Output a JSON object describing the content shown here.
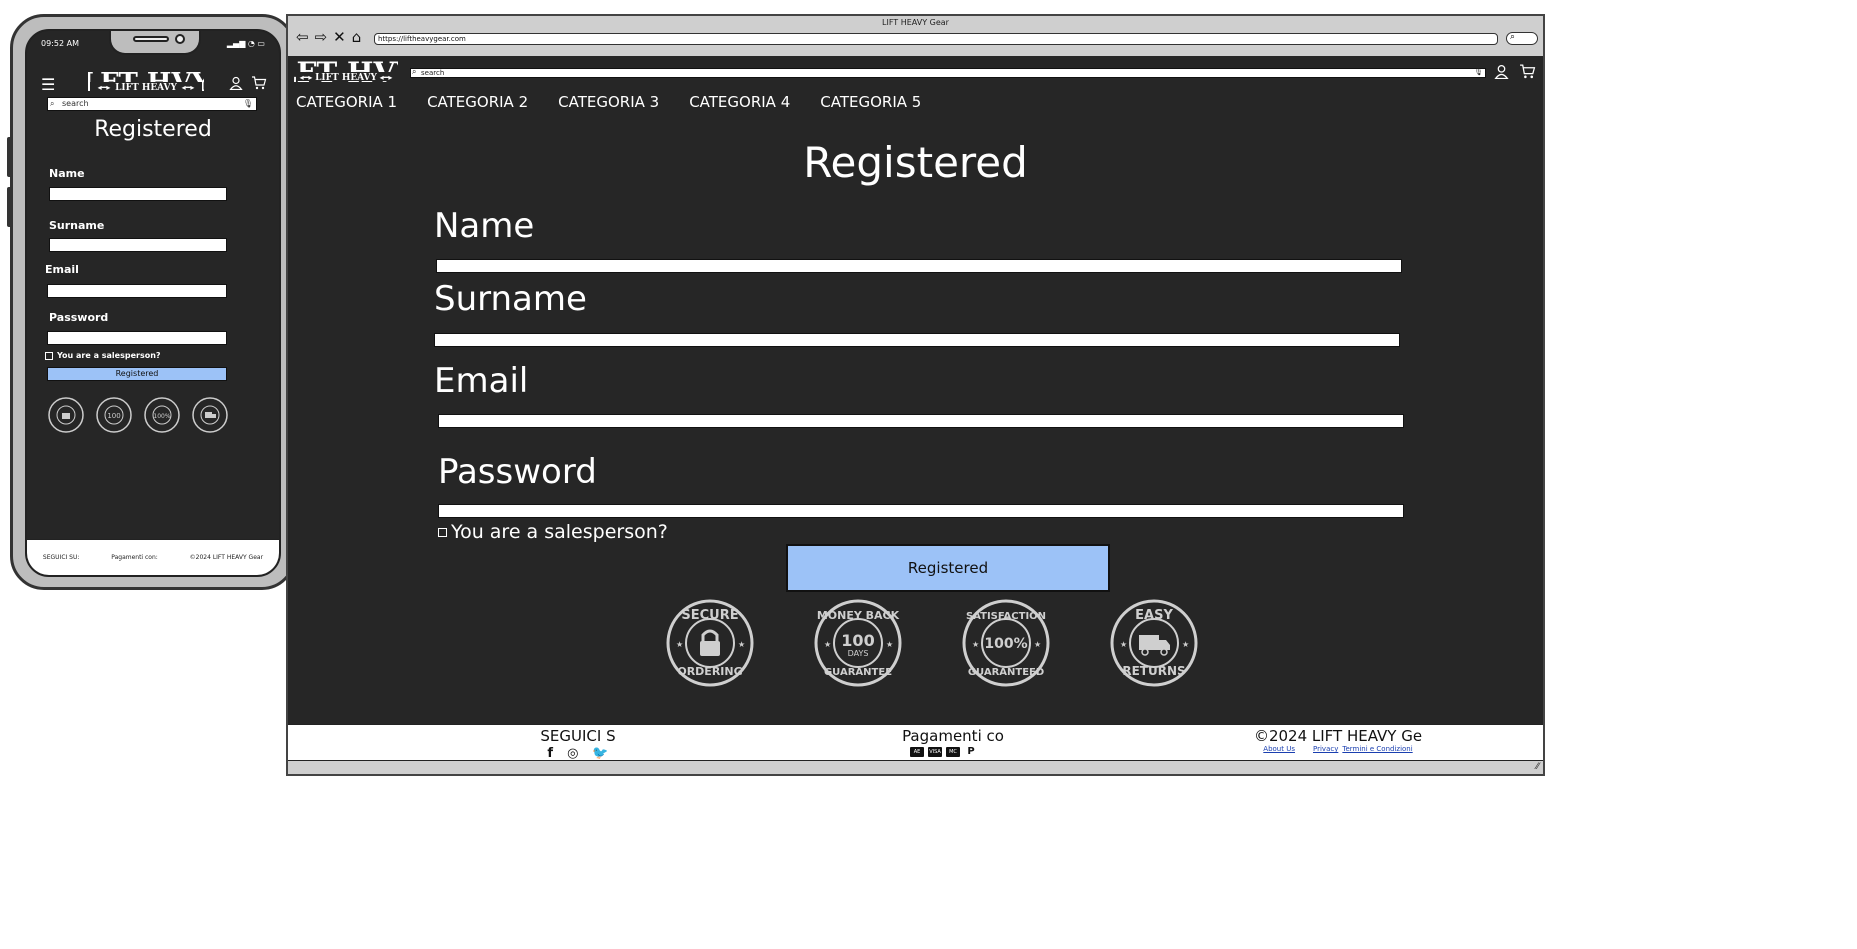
{
  "mobile": {
    "time": "09:52 AM",
    "search_placeholder": "search",
    "page_title": "Registered",
    "labels": {
      "name": "Name",
      "surname": "Surname",
      "email": "Email",
      "password": "Password"
    },
    "salesperson_label": "You are a salesperson?",
    "submit_label": "Registered",
    "footer": {
      "follow": "SEGUICI SU:",
      "payments": "Pagamenti con:",
      "copyright": "©2024 LIFT HEAVY Gear"
    }
  },
  "browser": {
    "window_title": "LIFT HEAVY Gear",
    "url": "https://liftheavygear.com",
    "search_placeholder": "search",
    "categories": [
      "CATEGORIA 1",
      "CATEGORIA 2",
      "CATEGORIA 3",
      "CATEGORIA 4",
      "CATEGORIA 5"
    ],
    "page_title": "Registered",
    "labels": {
      "name": "Name",
      "surname": "Surname",
      "email": "Email",
      "password": "Password"
    },
    "salesperson_label": "You are a salesperson?",
    "submit_label": "Registered",
    "badges": {
      "secure": {
        "top": "SECURE",
        "bottom": "ORDERING"
      },
      "money": {
        "top": "MONEY BACK",
        "number": "100",
        "unit": "DAYS",
        "bottom": "GUARANTEE"
      },
      "satisfaction": {
        "top": "SATISFACTION",
        "number": "100%",
        "bottom": "GUARANTEED"
      },
      "returns": {
        "top": "EASY",
        "bottom": "RETURNS"
      }
    },
    "footer": {
      "follow": "SEGUICI S",
      "payments": "Pagamenti co",
      "copyright": "©2024 LIFT HEAVY Ge",
      "links": [
        "About Us",
        "Privacy",
        "Termini e Condizioni"
      ]
    }
  },
  "logo_text": "LIFT HEAVY",
  "colors": {
    "background": "#262626",
    "button": "#9cc2f7",
    "link": "#1a3fb0"
  }
}
